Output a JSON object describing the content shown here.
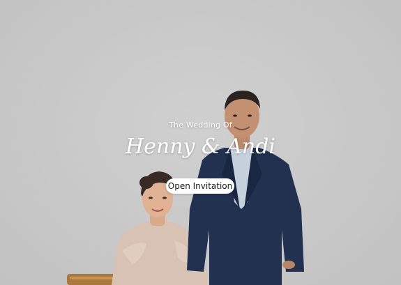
{
  "cover": {
    "subtitle": "The Wedding Of",
    "couple_names": "Henny & Andi",
    "open_button_label": "Open Invitation"
  },
  "colors": {
    "background": "#c9c9c9",
    "text": "#ffffff",
    "button_bg": "#ffffff",
    "button_text": "#1a1a1a",
    "suit": "#1f2d4a"
  },
  "icons": {
    "open_button": "none"
  }
}
